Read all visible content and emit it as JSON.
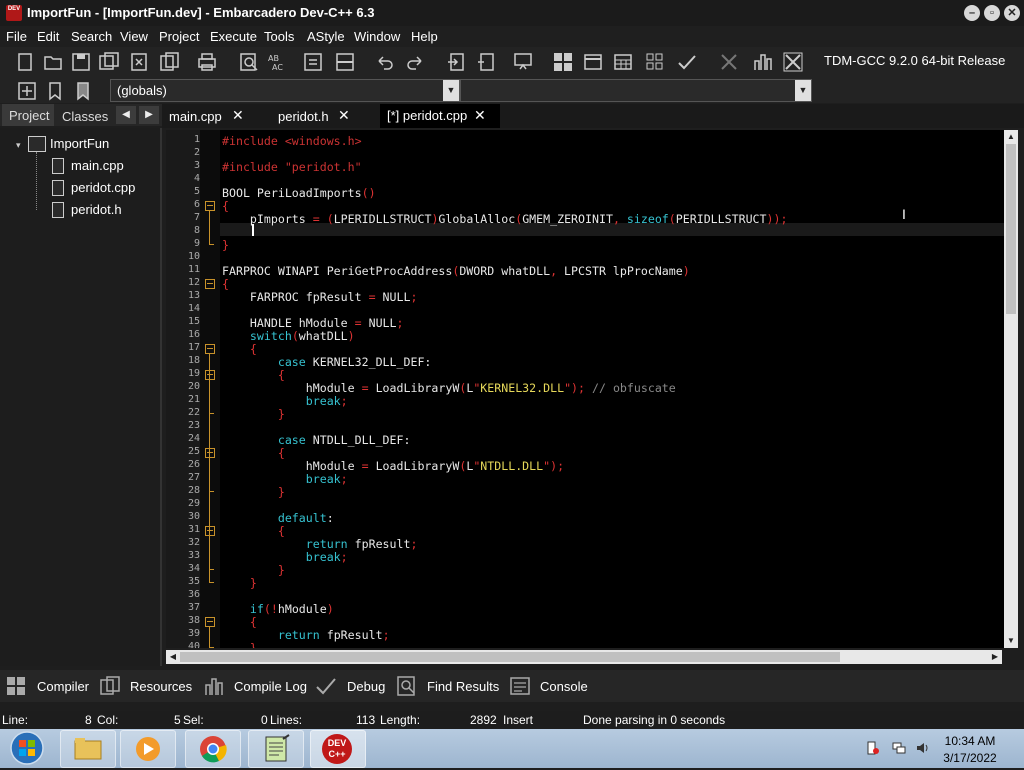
{
  "window": {
    "title": "ImportFun - [ImportFun.dev] - Embarcadero Dev-C++ 6.3",
    "icon_text": "DEV"
  },
  "menu": [
    "File",
    "Edit",
    "Search",
    "View",
    "Project",
    "Execute",
    "Tools",
    "AStyle",
    "Window",
    "Help"
  ],
  "toolbar": {
    "compiler": "TDM-GCC 9.2.0 64-bit Release",
    "globals": "(globals)",
    "icons": [
      "new-file-icon",
      "open-icon",
      "save-icon",
      "save-all-icon",
      "close-icon",
      "close-all-icon",
      "print-icon",
      "find-icon",
      "replace-icon",
      "indent-icon",
      "unindent-icon",
      "undo-icon",
      "redo-icon",
      "compile-icon",
      "run-icon",
      "debug-icon",
      "layout-icon",
      "window-icon",
      "grid-icon",
      "check-icon",
      "stop-icon",
      "chart-icon",
      "abort-icon"
    ]
  },
  "left_panel": {
    "tabs": [
      "Project",
      "Classes"
    ],
    "root": "ImportFun",
    "files": [
      "main.cpp",
      "peridot.cpp",
      "peridot.h"
    ]
  },
  "editor_tabs": [
    {
      "label": "main.cpp",
      "close": "✕"
    },
    {
      "label": "peridot.h",
      "close": "✕"
    },
    {
      "label": "[*] peridot.cpp",
      "close": "✕"
    }
  ],
  "code_lines": [
    "#include <windows.h>",
    "",
    "#include \"peridot.h\"",
    "",
    "BOOL PeriLoadImports()",
    "{",
    "    pImports = (LPERIDLLSTRUCT)GlobalAlloc(GMEM_ZEROINIT, sizeof(PERIDLLSTRUCT));",
    "    ",
    "}",
    "",
    "FARPROC WINAPI PeriGetProcAddress(DWORD whatDLL, LPCSTR lpProcName)",
    "{",
    "    FARPROC fpResult = NULL;",
    "",
    "    HANDLE hModule = NULL;",
    "    switch(whatDLL)",
    "    {",
    "        case KERNEL32_DLL_DEF:",
    "        {",
    "            hModule = LoadLibraryW(L\"KERNEL32.DLL\"); // obfuscate",
    "            break;",
    "        }",
    "",
    "        case NTDLL_DLL_DEF:",
    "        {",
    "            hModule = LoadLibraryW(L\"NTDLL.DLL\");",
    "            break;",
    "        }",
    "",
    "        default:",
    "        {",
    "            return fpResult;",
    "            break;",
    "        }",
    "    }",
    "",
    "    if(!hModule)",
    "    {",
    "        return fpResult;",
    "    }"
  ],
  "bottom_tabs": [
    "Compiler",
    "Resources",
    "Compile Log",
    "Debug",
    "Find Results",
    "Console"
  ],
  "status": {
    "line_label": "Line:",
    "line": "8",
    "col_label": "Col:",
    "col": "5",
    "sel_label": "Sel:",
    "sel": "0",
    "lines_label": "Lines:",
    "lines": "113",
    "length_label": "Length:",
    "length": "2892",
    "mode": "Insert",
    "message": "Done parsing in 0 seconds"
  },
  "taskbar": {
    "time": "10:34 AM",
    "date": "3/17/2022",
    "devcpp_icon_text": "DEV C++"
  }
}
